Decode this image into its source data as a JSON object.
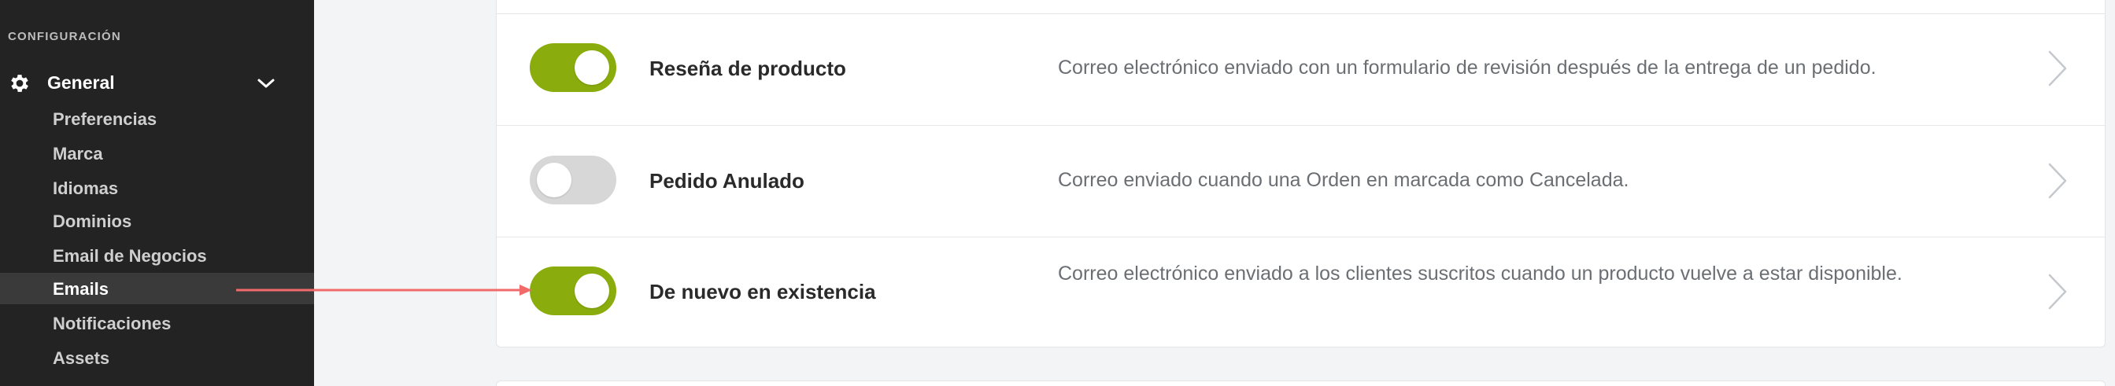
{
  "sidebar": {
    "section_title": "CONFIGURACIÓN",
    "group": {
      "label": "General",
      "icon": "gear-icon",
      "expanded_icon": "chevron-down-icon"
    },
    "items": [
      {
        "label": "Preferencias"
      },
      {
        "label": "Marca"
      },
      {
        "label": "Idiomas"
      },
      {
        "label": "Dominios"
      },
      {
        "label": "Email de Negocios"
      },
      {
        "label": "Emails",
        "active": true
      },
      {
        "label": "Notificaciones"
      },
      {
        "label": "Assets"
      }
    ]
  },
  "emails": [
    {
      "title": "Reseña de producto",
      "description": "Correo electrónico enviado con un formulario de revisión después de la entrega de un pedido.",
      "enabled": true
    },
    {
      "title": "Pedido Anulado",
      "description": "Correo enviado cuando una Orden en marcada como Cancelada.",
      "enabled": false
    },
    {
      "title": "De nuevo en existencia",
      "description": "Correo electrónico enviado a los clientes suscritos cuando un producto vuelve a estar disponible.",
      "enabled": true
    }
  ],
  "colors": {
    "sidebar_bg": "#232323",
    "toggle_on": "#8aac0c",
    "toggle_off": "#d7d7d7",
    "annotation_arrow": "#f26b6b"
  }
}
